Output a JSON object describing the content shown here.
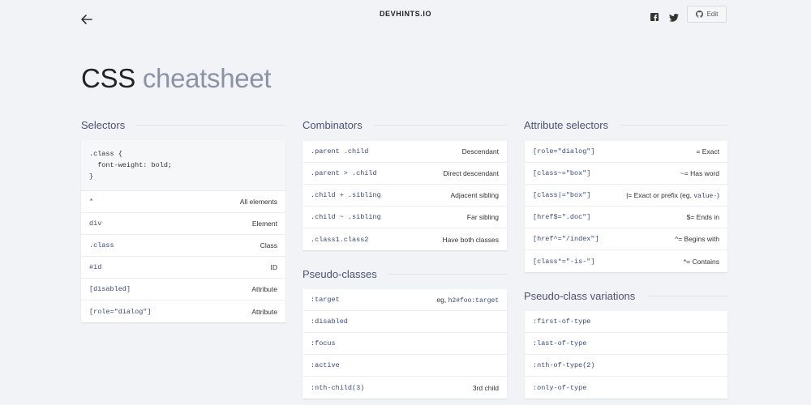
{
  "header": {
    "brand": "DEVHINTS.IO",
    "edit_label": "Edit",
    "icons": [
      "arrow-left-icon",
      "facebook-icon",
      "twitter-icon",
      "github-icon"
    ]
  },
  "page": {
    "title_main": "CSS",
    "title_light": "cheatsheet"
  },
  "selectors": {
    "heading": "Selectors",
    "code_example": ".class {\n  font-weight: bold;\n}",
    "rows": [
      {
        "code": "*",
        "desc": "All elements"
      },
      {
        "code": "div",
        "desc": "Element"
      },
      {
        "code": ".class",
        "desc": "Class"
      },
      {
        "code": "#id",
        "desc": "ID"
      },
      {
        "code": "[disabled]",
        "desc": "Attribute"
      },
      {
        "code": "[role=\"dialog\"]",
        "desc": "Attribute"
      }
    ]
  },
  "combinators": {
    "heading": "Combinators",
    "rows": [
      {
        "code": ".parent .child",
        "desc": "Descendant"
      },
      {
        "code": ".parent > .child",
        "desc": "Direct descendant"
      },
      {
        "code": ".child + .sibling",
        "desc": "Adjacent sibling"
      },
      {
        "code": ".child ~ .sibling",
        "desc": "Far sibling"
      },
      {
        "code": ".class1.class2",
        "desc": "Have both classes"
      }
    ]
  },
  "pseudo_classes": {
    "heading": "Pseudo-classes",
    "rows": [
      {
        "code": ":target",
        "desc_prefix": "eg,",
        "desc_code": "h2#foo:target"
      },
      {
        "code": ":disabled",
        "desc": ""
      },
      {
        "code": ":focus",
        "desc": ""
      },
      {
        "code": ":active",
        "desc": ""
      },
      {
        "code": ":nth-child(3)",
        "desc": "3rd child"
      }
    ]
  },
  "attribute_selectors": {
    "heading": "Attribute selectors",
    "rows": [
      {
        "code": "[role=\"dialog\"]",
        "desc": "= Exact"
      },
      {
        "code": "[class~=\"box\"]",
        "desc": "~= Has word"
      },
      {
        "code": "[class|=\"box\"]",
        "desc_prefix": "|= Exact or prefix (eg,",
        "desc_code": "value-",
        "desc_suffix": ")"
      },
      {
        "code": "[href$=\".doc\"]",
        "desc": "$= Ends in"
      },
      {
        "code": "[href^=\"/index\"]",
        "desc": "^= Begins with"
      },
      {
        "code": "[class*=\"-is-\"]",
        "desc": "*= Contains"
      }
    ]
  },
  "pseudo_class_variations": {
    "heading": "Pseudo-class variations",
    "rows": [
      {
        "code": ":first-of-type"
      },
      {
        "code": ":last-of-type"
      },
      {
        "code": ":nth-of-type(2)"
      },
      {
        "code": ":only-of-type"
      }
    ]
  },
  "colors": {
    "background": "#f2f3f7",
    "heading": "#4a5373",
    "code_text": "#3a4a7a",
    "title_light": "#8a93a6"
  }
}
